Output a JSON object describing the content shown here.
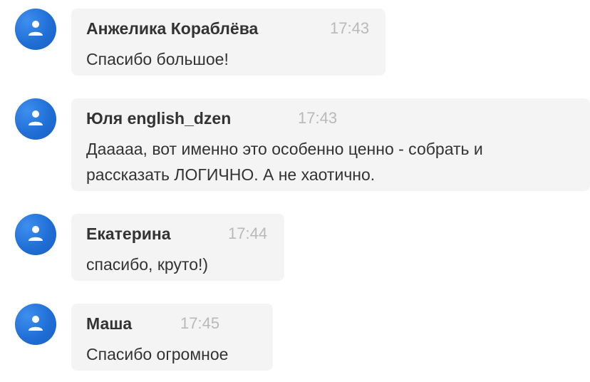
{
  "messages": [
    {
      "author": "Анжелика Кораблёва",
      "time": "17:43",
      "lines": [
        "Спасибо большое!"
      ]
    },
    {
      "author": "Юля english_dzen",
      "time": "17:43",
      "lines": [
        "Даааaa, вот именно это особенно ценно - собрать и",
        "рассказать ЛОГИЧНО. А не хаотично."
      ]
    },
    {
      "author": "Екатерина",
      "time": "17:44",
      "lines": [
        "спасибо, круто!)"
      ]
    },
    {
      "author": "Маша",
      "time": "17:45",
      "lines": [
        "Спасибо огромное"
      ]
    }
  ],
  "colors": {
    "avatar": "#1f6fd6",
    "bubble": "#f4f4f4",
    "author_text": "#333333",
    "time_text": "#b9b9b9"
  },
  "icons": {
    "avatar": "user-icon"
  }
}
